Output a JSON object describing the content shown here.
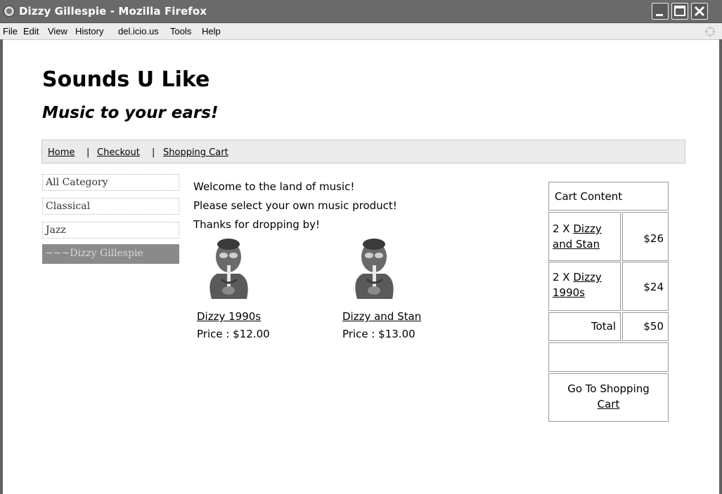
{
  "window": {
    "title": "Dizzy Gillespie - Mozilla Firefox"
  },
  "menubar": {
    "file": "File",
    "edit": "Edit",
    "view": "View",
    "history": "History",
    "delicious": "del.icio.us",
    "tools": "Tools",
    "help": "Help"
  },
  "site": {
    "title": "Sounds U Like",
    "slogan": "Music to your ears!"
  },
  "nav": {
    "home": "Home",
    "checkout": "Checkout",
    "cart": "Shopping Cart",
    "separator": "|"
  },
  "categories": [
    {
      "label": "All Category"
    },
    {
      "label": "Classical"
    },
    {
      "label": "Jazz"
    },
    {
      "label": "~~~Dizzy Gillespie"
    }
  ],
  "welcome": {
    "line1": "Welcome to the land of music!",
    "line2": "Please select your own music product!",
    "line3": "Thanks for dropping by!"
  },
  "products": [
    {
      "name": "Dizzy 1990s",
      "price": "Price : $12.00"
    },
    {
      "name": "Dizzy and Stan",
      "price": "Price : $13.00"
    }
  ],
  "cart": {
    "heading": "Cart Content",
    "items": [
      {
        "prefix": "2 X",
        "name_line1": "Dizzy",
        "name_line2": "and Stan",
        "price": "$26"
      },
      {
        "prefix": "2 X",
        "name_line1": "Dizzy",
        "name_line2": "1990s",
        "price": "$24"
      }
    ],
    "total_label": "Total",
    "total_value": "$50",
    "goto_line1": "Go To Shopping",
    "goto_line2": "Cart"
  },
  "icons": {
    "browser": "firefox-icon",
    "minimize": "minimize-icon",
    "maximize": "maximize-icon",
    "close": "close-icon",
    "throbber": "throbber-icon",
    "product": "trumpet-player-icon"
  }
}
